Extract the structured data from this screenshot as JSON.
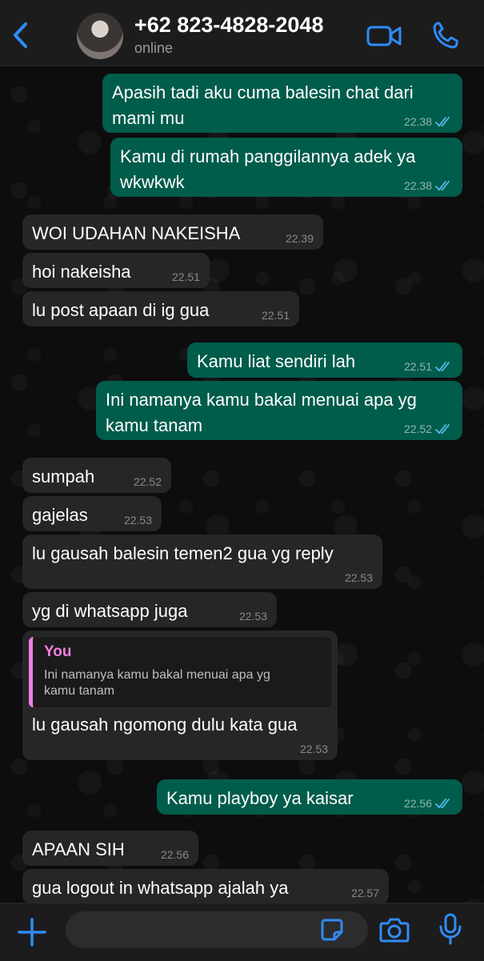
{
  "header": {
    "contact_name": "+62 823-4828-2048",
    "status": "online",
    "icons": [
      "chevron-left-icon",
      "avatar",
      "video-call-icon",
      "phone-icon"
    ]
  },
  "messages": [
    {
      "dir": "out",
      "text": "Apasih tadi aku cuma balesin chat dari\nmami mu",
      "time": "22.38",
      "read": true
    },
    {
      "dir": "out",
      "text": "Kamu di rumah panggilannya adek ya\nwkwkwk",
      "time": "22.38",
      "read": true
    },
    {
      "dir": "in",
      "text": "WOI UDAHAN NAKEISHA",
      "time": "22.39"
    },
    {
      "dir": "in",
      "text": "hoi nakeisha",
      "time": "22.51"
    },
    {
      "dir": "in",
      "text": "lu post apaan di ig gua",
      "time": "22.51"
    },
    {
      "dir": "out",
      "text": "Kamu liat sendiri lah",
      "time": "22.51",
      "read": true
    },
    {
      "dir": "out",
      "text": "Ini namanya kamu bakal menuai apa yg\nkamu tanam",
      "time": "22.52",
      "read": true
    },
    {
      "dir": "in",
      "text": "sumpah",
      "time": "22.52"
    },
    {
      "dir": "in",
      "text": "gajelas",
      "time": "22.53"
    },
    {
      "dir": "in",
      "text": "lu gausah balesin temen2 gua yg reply",
      "time": "22.53"
    },
    {
      "dir": "in",
      "text": "yg di whatsapp juga",
      "time": "22.53"
    },
    {
      "dir": "in",
      "text": "lu gausah ngomong dulu kata gua",
      "time": "22.53",
      "quote": {
        "author": "You",
        "text": "Ini namanya kamu bakal menuai apa yg\nkamu tanam"
      }
    },
    {
      "dir": "out",
      "text": "Kamu playboy ya kaisar",
      "time": "22.56",
      "read": true
    },
    {
      "dir": "in",
      "text": "APAAN SIH",
      "time": "22.56"
    },
    {
      "dir": "in",
      "text": "gua logout in whatsapp ajalah ya",
      "time": "22.57"
    }
  ],
  "composer": {
    "value": "",
    "icons": [
      "plus-icon",
      "sticker-icon",
      "camera-icon",
      "microphone-icon"
    ]
  },
  "colors": {
    "accent": "#2f8cf5",
    "outgoing_bubble": "#005c4b",
    "incoming_bubble": "#262626",
    "read_ticks": "#53bdeb",
    "quote_author": "#f07ee0"
  }
}
